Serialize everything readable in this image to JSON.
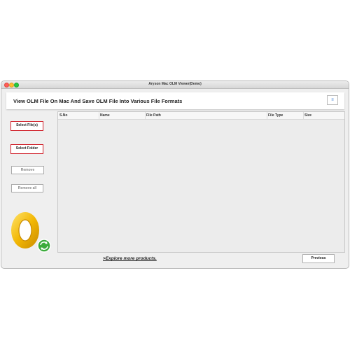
{
  "window": {
    "title": "Aryson Mac OLM Viewer(Demo)"
  },
  "header": {
    "title": "View OLM File On Mac And Save OLM File Into Various File Formats",
    "menu_icon": "≡"
  },
  "sidebar": {
    "select_files": "Select File(s)",
    "select_folder": "Select Folder",
    "remove": "Remove",
    "remove_all": "Remove all"
  },
  "table": {
    "columns": [
      "S.No",
      "Name",
      "File Path",
      "File Type",
      "Size"
    ]
  },
  "footer": {
    "explore": ">Explore more products.",
    "previous": "Previous"
  },
  "colors": {
    "accent_red": "#d0202a",
    "logo_gold": "#f2b705",
    "sync_green": "#3cab3c"
  }
}
